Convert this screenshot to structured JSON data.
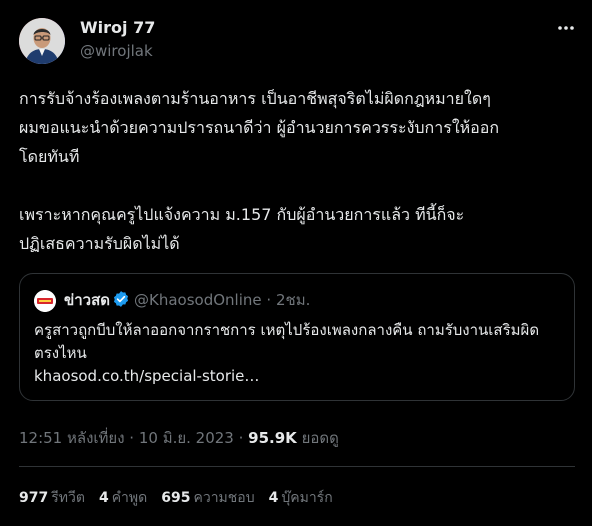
{
  "author": {
    "display_name": "Wiroj 77",
    "handle": "@wirojlak",
    "avatar_icon": "user-avatar"
  },
  "more_icon": "more-options-icon",
  "tweet": {
    "text": "การรับจ้างร้องเพลงตามร้านอาหาร เป็นอาชีพสุจริตไม่ผิดกฎหมายใดๆ\nผมขอแนะนำด้วยความปรารถนาดีว่า ผู้อำนวยการควรระงับการให้ออก\nโดยทันที\n\nเพราะหากคุณครูไปแจ้งความ ม.157 กับผู้อำนวยการแล้ว ทีนี้ก็จะ\nปฏิเสธความรับผิดไม่ได้"
  },
  "quote": {
    "name": "ข่าวสด",
    "handle": "@KhaosodOnline",
    "dot": "·",
    "time": "2ชม.",
    "text": "ครูสาวถูกบีบให้ลาออกจากราชการ เหตุไปร้องเพลงกลางคืน ถามรับงานเสริมผิดตรงไหน",
    "link": "khaosod.co.th/special-storie…",
    "verified_color": "#1d9bf0"
  },
  "meta": {
    "time": "12:51 หลังเที่ยง",
    "sep": " · ",
    "date": "10 มิ.ย. 2023",
    "views_num": "95.9K",
    "views_label": "ยอดดู"
  },
  "stats": [
    {
      "num": "977",
      "label": "รีทวีต"
    },
    {
      "num": "4",
      "label": "คำพูด"
    },
    {
      "num": "695",
      "label": "ความชอบ"
    },
    {
      "num": "4",
      "label": "บุ๊คมาร์ก"
    }
  ],
  "colors": {
    "background": "#000000",
    "text": "#e7e9ea",
    "muted": "#71767b",
    "border": "#2f3336",
    "accent": "#1d9bf0"
  }
}
